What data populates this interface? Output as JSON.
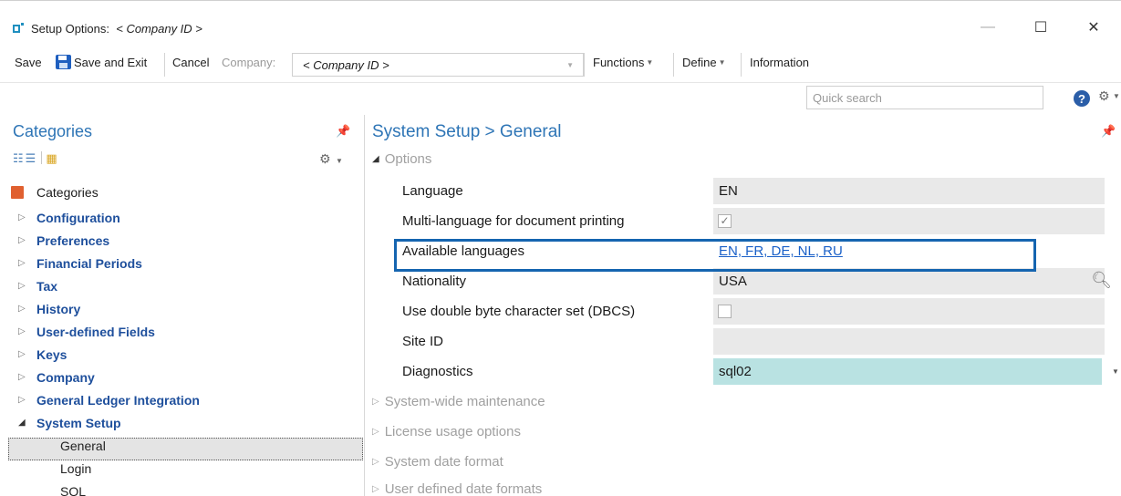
{
  "window": {
    "title_prefix": "Setup Options:",
    "title_company": "< Company ID >",
    "min_icon": "—",
    "max_icon": "☐",
    "close_icon": "✕"
  },
  "toolbar": {
    "save": "Save",
    "save_exit": "Save and Exit",
    "cancel": "Cancel",
    "company_label": "Company:",
    "company_value": "< Company ID >",
    "functions": "Functions",
    "define": "Define",
    "information": "Information"
  },
  "search": {
    "placeholder": "Quick search",
    "help_glyph": "?"
  },
  "categories": {
    "title": "Categories",
    "root": "Categories",
    "items": [
      {
        "label": "Configuration",
        "expanded": false
      },
      {
        "label": "Preferences",
        "expanded": false
      },
      {
        "label": "Financial Periods",
        "expanded": false
      },
      {
        "label": "Tax",
        "expanded": false
      },
      {
        "label": "History",
        "expanded": false
      },
      {
        "label": "User-defined Fields",
        "expanded": false
      },
      {
        "label": "Keys",
        "expanded": false
      },
      {
        "label": "Company",
        "expanded": false
      },
      {
        "label": "General Ledger Integration",
        "expanded": false
      },
      {
        "label": "System Setup",
        "expanded": true
      }
    ],
    "children": [
      {
        "label": "General",
        "selected": true
      },
      {
        "label": "Login",
        "selected": false
      },
      {
        "label": "SQL",
        "selected": false
      }
    ]
  },
  "main": {
    "title": "System Setup > General",
    "options_group": "Options",
    "properties": [
      {
        "label": "Language",
        "value": "EN",
        "kind": "text"
      },
      {
        "label": "Multi-language for document printing",
        "value": "✓",
        "kind": "checkbox",
        "checked": true
      },
      {
        "label": "Available languages",
        "value": "EN, FR, DE, NL, RU",
        "kind": "link"
      },
      {
        "label": "Nationality",
        "value": "USA",
        "kind": "text-search"
      },
      {
        "label": "Use double byte character set (DBCS)",
        "value": "",
        "kind": "checkbox",
        "checked": false
      },
      {
        "label": "Site ID",
        "value": "",
        "kind": "text"
      },
      {
        "label": "Diagnostics",
        "value": "sql02",
        "kind": "dropdown",
        "highlighted": true
      }
    ],
    "collapsed_groups": [
      "System-wide maintenance",
      "License usage options",
      "System date format",
      "User defined date formats"
    ]
  },
  "colors": {
    "accent_blue": "#2e75b6",
    "highlight_border": "#1565b0",
    "diagnostics_fill": "#b9e2e2",
    "tree_link": "#1e4f9c",
    "root_square": "#e06030"
  }
}
